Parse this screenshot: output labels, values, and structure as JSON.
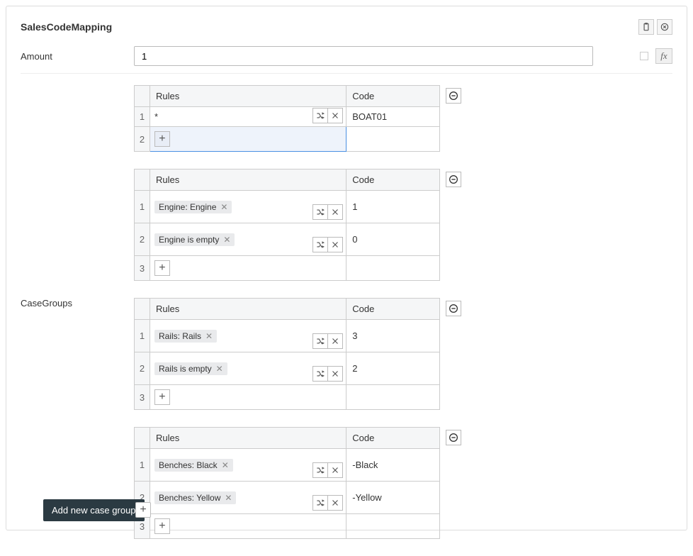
{
  "title": "SalesCodeMapping",
  "amount": {
    "label": "Amount",
    "value": "1"
  },
  "fx_label": "fx",
  "caseGroups": {
    "label": "CaseGroups",
    "headers": {
      "rules": "Rules",
      "code": "Code"
    },
    "tooltip": "Add new case group",
    "plus": "+",
    "groups": [
      {
        "rows": [
          {
            "idx": "1",
            "star": "*",
            "tag": null,
            "code": "BOAT01",
            "showActions": true,
            "singleLine": true
          },
          {
            "idx": "2",
            "addHighlighted": true
          }
        ]
      },
      {
        "rows": [
          {
            "idx": "1",
            "tag": "Engine: Engine",
            "code": "1",
            "showActions": true
          },
          {
            "idx": "2",
            "tag": "Engine is empty",
            "code": "0",
            "showActions": true
          },
          {
            "idx": "3",
            "add": true
          }
        ]
      },
      {
        "rows": [
          {
            "idx": "1",
            "tag": "Rails: Rails",
            "code": "3",
            "showActions": true
          },
          {
            "idx": "2",
            "tag": "Rails is empty",
            "code": "2",
            "showActions": true
          },
          {
            "idx": "3",
            "add": true
          }
        ]
      },
      {
        "rows": [
          {
            "idx": "1",
            "tag": "Benches: Black",
            "code": "-Black",
            "showActions": true
          },
          {
            "idx": "2",
            "tag": "Benches: Yellow",
            "code": "-Yellow",
            "showActions": true
          },
          {
            "idx": "3",
            "add": true
          }
        ]
      }
    ]
  }
}
